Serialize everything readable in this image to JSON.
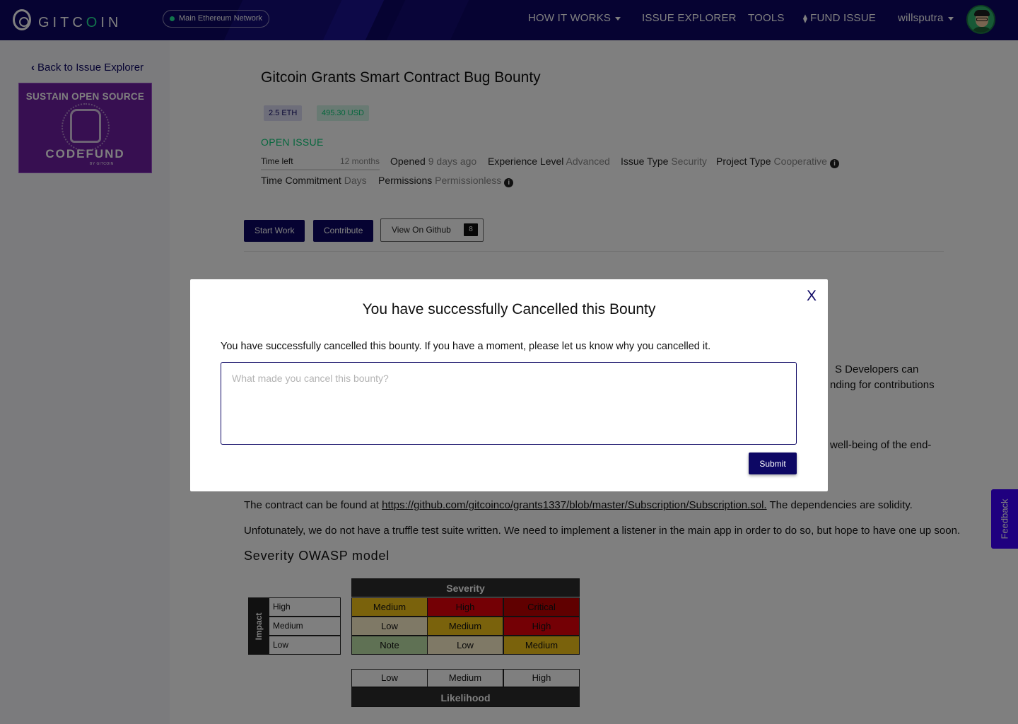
{
  "nav": {
    "logo_prefix": "GITC",
    "logo_o": "O",
    "logo_suffix": "IN",
    "network": "Main Ethereum Network",
    "how_it_works": "HOW IT WORKS",
    "issue_explorer": "ISSUE EXPLORER",
    "tools": "TOOLS",
    "fund_issue": "FUND ISSUE",
    "username": "willsputra"
  },
  "sidebar": {
    "back_link": "Back to Issue Explorer",
    "ad_title": "SUSTAIN OPEN SOURCE",
    "ad_brand": "CODEFUND",
    "ad_sub": "BY GITCOIN"
  },
  "issue": {
    "title": "Gitcoin Grants Smart Contract Bug Bounty",
    "amount_eth": "2.5 ETH",
    "amount_usd": "495.30 USD",
    "status": "OPEN ISSUE",
    "time_left_label": "Time left",
    "time_left_value": "12 months",
    "opened_label": "Opened",
    "opened_value": "9 days ago",
    "experience_label": "Experience Level",
    "experience_value": "Advanced",
    "issue_type_label": "Issue Type",
    "issue_type_value": "Security",
    "project_type_label": "Project Type",
    "project_type_value": "Cooperative",
    "commitment_label": "Time Commitment",
    "commitment_value": "Days",
    "permissions_label": "Permissions",
    "permissions_value": "Permissionless"
  },
  "actions": {
    "start_work": "Start Work",
    "contribute": "Contribute",
    "view_github": "View On Github",
    "github_count": "8"
  },
  "body": {
    "line1_right": "S Developers can",
    "line2_right": "nding for contributions",
    "line3_right": "well-being of the end-",
    "contract_prefix": "The contract can be found at ",
    "contract_link": "https://github.com/gitcoinco/grants1337/blob/master/Subscription/Subscription.sol.",
    "contract_suffix": " The dependencies are solidity.",
    "truffle": "Unfotunately, we do not have a truffle test suite written. We need to implement a listener in the main app in order to do so, but hope to have one up soon.",
    "severity_heading": "Severity OWASP model"
  },
  "owasp": {
    "impact_label": "Impact",
    "impact_rows": [
      "High",
      "Medium",
      "Low"
    ],
    "severity_header": "Severity",
    "matrix": [
      [
        "Medium",
        "High",
        "Critical"
      ],
      [
        "Low",
        "Medium",
        "High"
      ],
      [
        "Note",
        "Low",
        "Medium"
      ]
    ],
    "likelihood_cols": [
      "Low",
      "Medium",
      "High"
    ],
    "likelihood_label": "Likelihood",
    "colors": {
      "note": "#bfe3a8",
      "low": "#fff2cc",
      "medium": "#f5c518",
      "high": "#e8000b",
      "critical": "#c00000"
    }
  },
  "feedback": "Feedback",
  "modal": {
    "close": "X",
    "title": "You have successfully Cancelled this Bounty",
    "description": "You have successfully cancelled this bounty. If you have a moment, please let us know why you cancelled it.",
    "placeholder": "What made you cancel this bounty?",
    "submit": "Submit"
  }
}
